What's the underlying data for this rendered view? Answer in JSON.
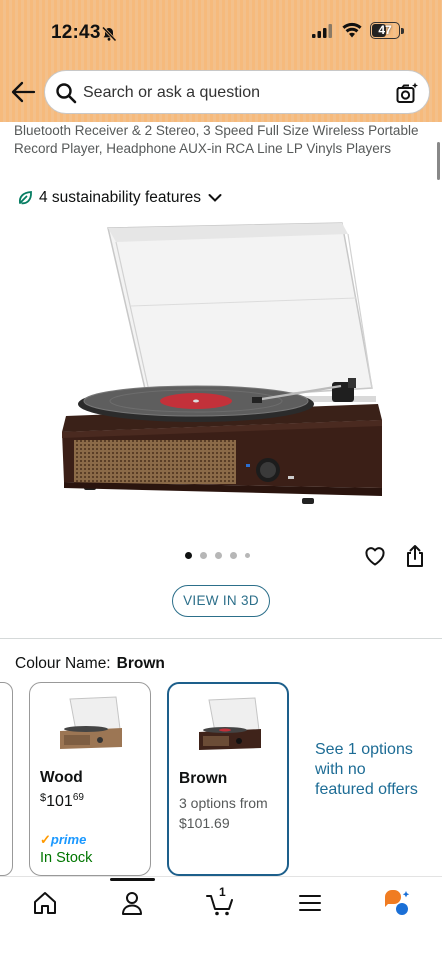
{
  "status_bar": {
    "time": "12:43",
    "battery": "47"
  },
  "search": {
    "placeholder": "Search or ask a question"
  },
  "product": {
    "title": "Bluetooth Receiver & 2 Stereo, 3 Speed Full Size Wireless Portable Record Player, Headphone AUX-in RCA Line LP Vinyls Players",
    "sustainability": "4 sustainability features",
    "view_3d": "VIEW IN 3D",
    "image_count": 5,
    "active_image": 1
  },
  "colour": {
    "label": "Colour Name:",
    "selected": "Brown",
    "options": [
      {
        "name": "Wood",
        "price_currency": "$",
        "price_whole": "101",
        "price_fraction": "69",
        "prime": "prime",
        "stock": "In Stock"
      },
      {
        "name": "Brown",
        "options_text": "3 options from",
        "price": "$101.69"
      }
    ],
    "see_options": "See 1 options with no featured offers"
  },
  "tabbar": {
    "cart_count": "1",
    "items": [
      "home-icon",
      "account-icon",
      "cart-icon",
      "menu-icon",
      "rufus-assistant-icon"
    ]
  },
  "colors": {
    "header": "#f6ba7c",
    "link": "#1d6c95",
    "selected_border": "#1d5f8b",
    "stock": "#007600",
    "sustainability": "#067d62"
  }
}
